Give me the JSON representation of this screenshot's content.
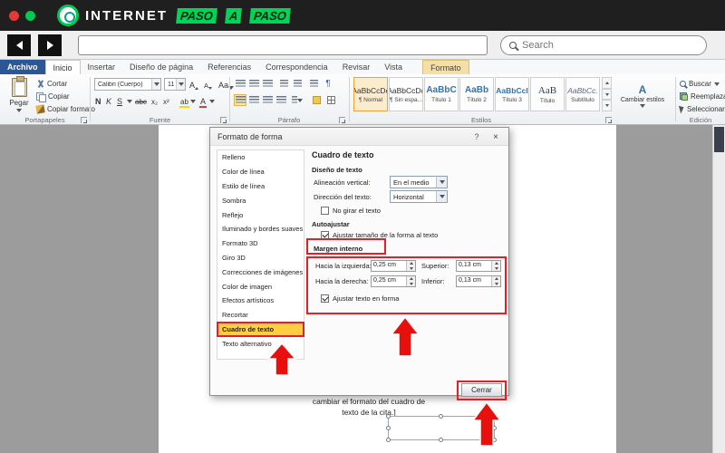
{
  "window": {
    "brand": {
      "word1": "INTERNET",
      "word2": "PASO",
      "word3": "A",
      "word4": "PASO"
    },
    "search_placeholder": "Search"
  },
  "ribbon_tabs": [
    "Archivo",
    "Inicio",
    "Insertar",
    "Diseño de página",
    "Referencias",
    "Correspondencia",
    "Revisar",
    "Vista",
    "Formato"
  ],
  "clipboard": {
    "group": "Portapapeles",
    "paste": "Pegar",
    "cut": "Cortar",
    "copy": "Copiar",
    "format_painter": "Copiar formato"
  },
  "font": {
    "group": "Fuente",
    "name": "Calibri (Cuerpo)",
    "size": "11",
    "bold": "N",
    "italic": "K",
    "underline": "S",
    "strike": "abc",
    "subscript": "x₂",
    "superscript": "x²",
    "grow": "A",
    "shrink": "A",
    "change_case": "Aa",
    "highlight": "ab",
    "color": "A"
  },
  "paragraph": {
    "group": "Párrafo",
    "pilcrow": "¶"
  },
  "styles": {
    "group": "Estilos",
    "change": "Cambiar estilos",
    "change_icon": "A",
    "items": [
      {
        "sample": "AaBbCcDc",
        "name": "¶ Normal"
      },
      {
        "sample": "AaBbCcDc",
        "name": "¶ Sin espa..."
      },
      {
        "sample": "AaBbC",
        "name": "Título 1"
      },
      {
        "sample": "AaBb",
        "name": "Título 2"
      },
      {
        "sample": "AaBbCcI",
        "name": "Título 3"
      },
      {
        "sample": "AaB",
        "name": "Título"
      },
      {
        "sample": "AaBbCc.",
        "name": "Subtítulo"
      }
    ]
  },
  "editing": {
    "group": "Edición",
    "find": "Buscar",
    "replace": "Reemplazar",
    "select": "Seleccionar"
  },
  "dialog": {
    "title": "Formato de forma",
    "help_icon": "?",
    "close_icon": "×",
    "sidebar": [
      "Relleno",
      "Color de línea",
      "Estilo de línea",
      "Sombra",
      "Reflejo",
      "Iluminado y bordes suaves",
      "Formato 3D",
      "Giro 3D",
      "Correcciones de imágenes",
      "Color de imagen",
      "Efectos artísticos",
      "Recortar",
      "Cuadro de texto",
      "Texto alternativo"
    ],
    "content": {
      "heading": "Cuadro de texto",
      "section_text_layout": "Diseño de texto",
      "vertical_alignment_label": "Alineación vertical:",
      "vertical_alignment_value": "En el medio",
      "text_direction_label": "Dirección del texto:",
      "text_direction_value": "Horizontal",
      "no_rotate_label": "No girar el texto",
      "section_autofit": "Autoajustar",
      "resize_shape_label": "Ajustar tamaño de la forma al texto",
      "section_margin": "Margen interno",
      "left_label": "Hacia la izquierda:",
      "left_value": "0,25 cm",
      "right_label": "Hacia la derecha:",
      "right_value": "0,25 cm",
      "top_label": "Superior:",
      "top_value": "0,13 cm",
      "bottom_label": "Inferior:",
      "bottom_value": "0,13 cm",
      "wrap_label": "Ajustar texto en forma",
      "close_button": "Cerrar"
    }
  },
  "document": {
    "line1": "cambiar el formato del cuadro de",
    "line2": "texto de la cita.]"
  },
  "colors": {
    "accent_red": "#ec1c24",
    "highlight_yellow": "#ffcf3f",
    "brand_green": "#00c853",
    "file_tab_blue": "#2b5797"
  }
}
